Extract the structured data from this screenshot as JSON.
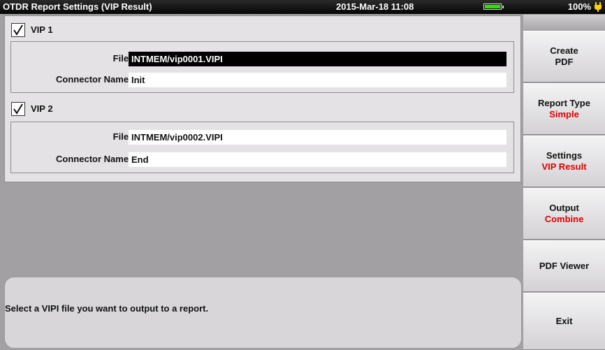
{
  "titlebar": {
    "title": "OTDR Report Settings (VIP Result)",
    "datetime": "2015-Mar-18 11:08",
    "battery_percent": "100%",
    "battery_level": 1.0,
    "battery_color": "#33dd11"
  },
  "vip1": {
    "label": "VIP 1",
    "checked": true,
    "file_label": "File :",
    "file_value": "INTMEM/vip0001.VIPI",
    "connector_label": "Connector Name :",
    "connector_value": "Init"
  },
  "vip2": {
    "label": "VIP 2",
    "checked": true,
    "file_label": "File :",
    "file_value": "INTMEM/vip0002.VIPI",
    "connector_label": "Connector Name :",
    "connector_value": "End"
  },
  "message": "Select a VIPI file you want to output to a report.",
  "softkeys": [
    {
      "label": "Create",
      "sub": "PDF",
      "sub_color": "#111111"
    },
    {
      "label": "Report Type",
      "sub": "Simple",
      "sub_color": "#e00000"
    },
    {
      "label": "Settings",
      "sub": "VIP Result",
      "sub_color": "#e00000"
    },
    {
      "label": "Output",
      "sub": "Combine",
      "sub_color": "#e00000"
    },
    {
      "label": "PDF Viewer",
      "sub": "",
      "sub_color": "#111111"
    },
    {
      "label": "Exit",
      "sub": "",
      "sub_color": "#111111"
    }
  ],
  "icons": {
    "checkbox_check": "checkmark-icon",
    "power_plug": "plug-icon"
  }
}
